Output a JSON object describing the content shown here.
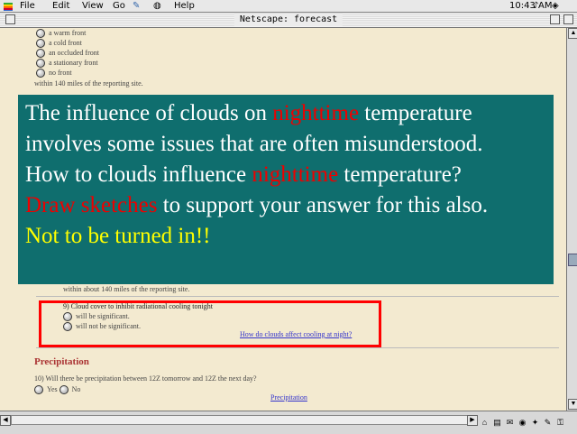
{
  "menubar": {
    "items": [
      "File",
      "Edit",
      "View",
      "Go",
      "Help"
    ],
    "time": "10:43 AM"
  },
  "window": {
    "title": "Netscape: forecast"
  },
  "page": {
    "top_lines": [
      "a warm front",
      "a cold front",
      "an occluded front",
      "a stationary front",
      "no front"
    ],
    "within_140_top": "within 140 miles of the reporting site.",
    "within_140_bottom": "within about 140 miles of the reporting site.",
    "q9": {
      "question": "9) Cloud cover to inhibit radiational cooling tonight",
      "opt1": "will be significant.",
      "opt2": "will not be significant.",
      "link": "How do clouds affect cooling at night?"
    },
    "precip_heading": "Precipitation",
    "q10": {
      "question": "10) Will there be precipitation between 12Z tomorrow and 12Z the next day?",
      "yes": "Yes",
      "no": "No",
      "link": "Precipitation"
    }
  },
  "overlay": {
    "l1a": "The influence of clouds on ",
    "l1b": "nighttime",
    "l1c": " temperature",
    "l2": "involves some issues that are often misunderstood.",
    "l3a": "How to clouds influence ",
    "l3b": "nighttime",
    "l3c": " temperature?",
    "l4a": "Draw sketches",
    "l4b": " to support your answer for this also.",
    "l5": "Not to be turned in!!"
  },
  "colors": {
    "overlay_bg": "#0f6e6e",
    "highlight_red": "#e00000",
    "highlight_yellow": "#ffff00",
    "page_bg": "#f3ead0"
  }
}
